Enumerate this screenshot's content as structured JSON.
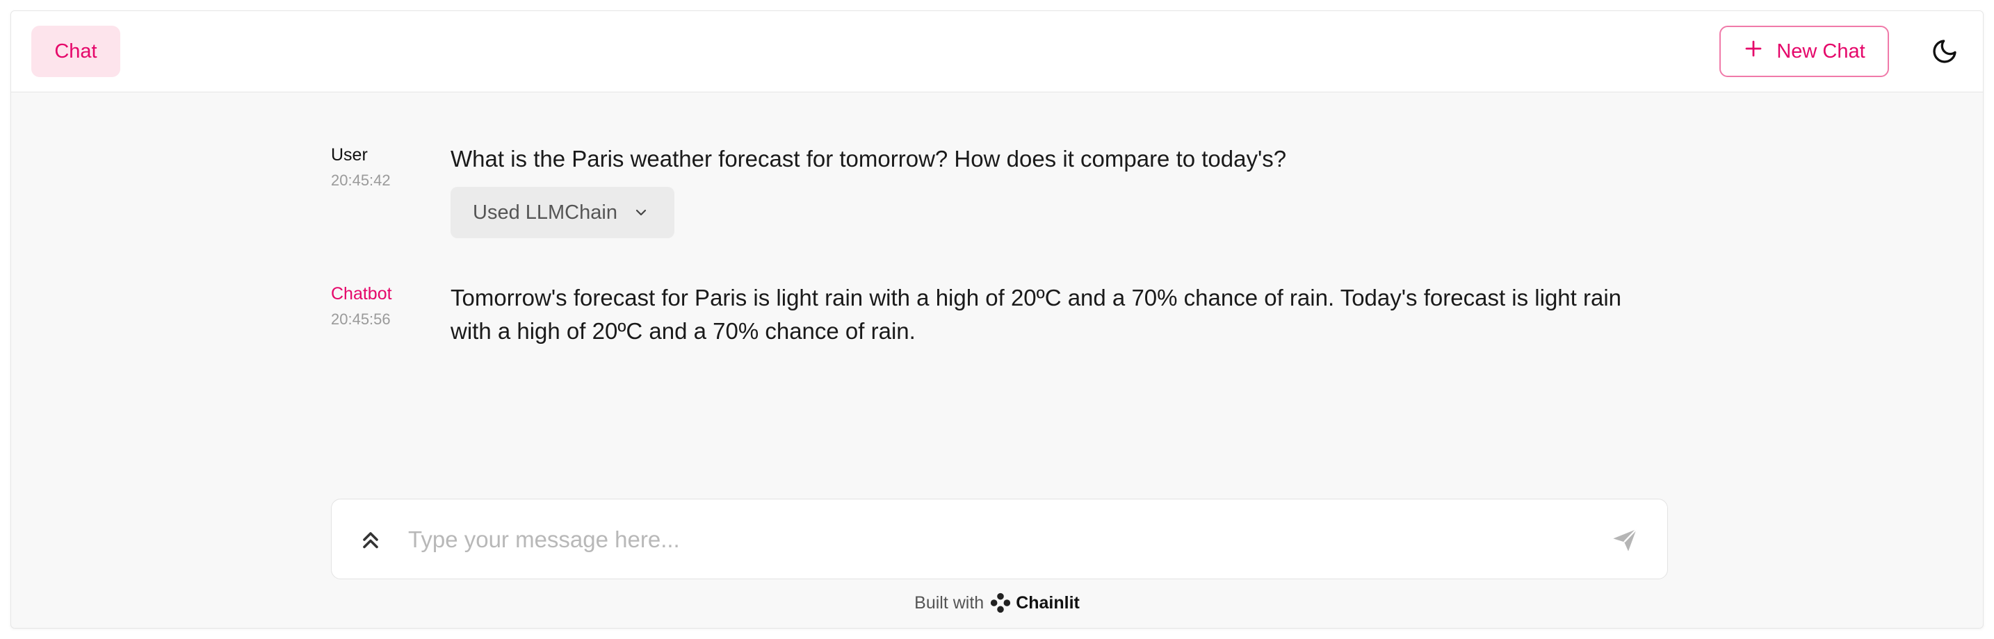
{
  "header": {
    "tab_label": "Chat",
    "new_chat_label": "New Chat",
    "accent_color": "#e5076a"
  },
  "messages": [
    {
      "author": "User",
      "time": "20:45:42",
      "content": "What is the Paris weather forecast for tomorrow? How does it compare to today's?",
      "step_label": "Used LLMChain"
    },
    {
      "author": "Chatbot",
      "time": "20:45:56",
      "content": "Tomorrow's forecast for Paris is light rain with a high of 20ºC and a 70% chance of rain. Today's forecast is light rain with a high of 20ºC and a 70% chance of rain."
    }
  ],
  "composer": {
    "placeholder": "Type your message here...",
    "value": ""
  },
  "footer": {
    "built_with": "Built with",
    "brand": "Chainlit"
  },
  "icons": {
    "plus": "plus-icon",
    "theme": "moon-icon",
    "chevron": "chevron-down-icon",
    "expand": "chevrons-up-icon",
    "send": "send-icon",
    "brand_logo": "chainlit-logo-icon"
  }
}
